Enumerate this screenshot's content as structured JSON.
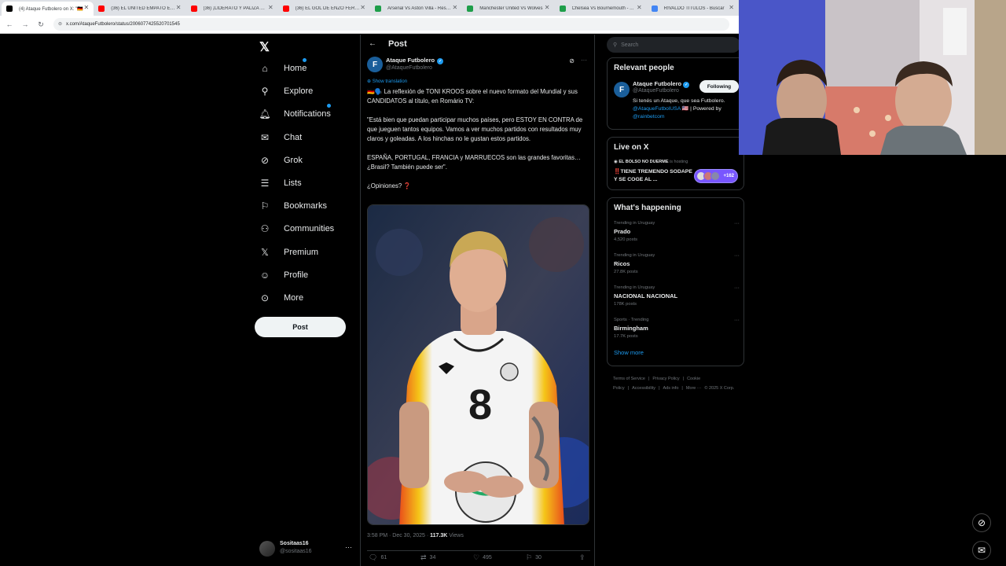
{
  "browser": {
    "tabs": [
      {
        "label": "(4) Ataque Futbolero on X: \"🇩🇪",
        "fav": "#000000",
        "active": true
      },
      {
        "label": "(36) EL UNITED EMPATÓ EN CU",
        "fav": "#ff0000",
        "active": false
      },
      {
        "label": "(36) ¡LIDERATO Y PALIZA GUNI",
        "fav": "#ff0000",
        "active": false
      },
      {
        "label": "(36) EL GOL DE ENZO FERNÁN",
        "fav": "#ff0000",
        "active": false
      },
      {
        "label": "Arsenal Vs Aston Villa - Resulta",
        "fav": "#1e9e4a",
        "active": false
      },
      {
        "label": "Manchester United Vs Wolves",
        "fav": "#1e9e4a",
        "active": false
      },
      {
        "label": "Chelsea Vs Bournemouth - Alin",
        "fav": "#1e9e4a",
        "active": false
      },
      {
        "label": "RIVALDO TITULOS - Buscar",
        "fav": "#4285f4",
        "active": false
      }
    ],
    "url": "x.com/AtaqueFutbolero/status/2006077425520701545"
  },
  "sidebar": {
    "items": [
      {
        "label": "Home",
        "icon": "home-icon",
        "glyph": "⌂",
        "dot": true
      },
      {
        "label": "Explore",
        "icon": "search-icon",
        "glyph": "⚲",
        "dot": false
      },
      {
        "label": "Notifications",
        "icon": "bell-icon",
        "glyph": "🔔︎",
        "dot": true
      },
      {
        "label": "Chat",
        "icon": "mail-icon",
        "glyph": "✉",
        "dot": false
      },
      {
        "label": "Grok",
        "icon": "grok-icon",
        "glyph": "⊘",
        "dot": false
      },
      {
        "label": "Lists",
        "icon": "list-icon",
        "glyph": "☰",
        "dot": false
      },
      {
        "label": "Bookmarks",
        "icon": "bookmark-icon",
        "glyph": "⚐",
        "dot": false
      },
      {
        "label": "Communities",
        "icon": "people-icon",
        "glyph": "⚇",
        "dot": false
      },
      {
        "label": "Premium",
        "icon": "x-icon",
        "glyph": "𝕏",
        "dot": false
      },
      {
        "label": "Profile",
        "icon": "person-icon",
        "glyph": "☺",
        "dot": false
      },
      {
        "label": "More",
        "icon": "more-circle-icon",
        "glyph": "⊙",
        "dot": false
      }
    ],
    "post_label": "Post",
    "account": {
      "name": "Sositaas16",
      "handle": "@sositaas16"
    }
  },
  "post": {
    "header_title": "Post",
    "author_name": "Ataque Futbolero",
    "author_handle": "@AtaqueFutbolero",
    "show_translation": "Show translation",
    "text": "🇩🇪🗣️ La reflexión de TONI KROOS sobre el nuevo formato del Mundial y sus CANDIDATOS al título, en Romário TV:\n\n\"Está bien que puedan participar muchos países, pero ESTOY EN CONTRA de que jueguen tantos equipos. Vamos a ver muchos partidos con resultados muy claros y goleadas. A los hinchas no le gustan estos partidos.\n\nESPAÑA, PORTUGAL, FRANCIA y MARRUECOS son las grandes favoritas… ¿Brasil? También puede ser\".\n\n¿Opiniones? ❓",
    "timestamp": "3:58 PM · Dec 30, 2025 · ",
    "views_count": "117.3K",
    "views_label": " Views",
    "replies": "61",
    "reposts": "34",
    "likes": "495",
    "bookmarks": "30",
    "jersey_number": "8"
  },
  "right": {
    "search_placeholder": "Search",
    "relevant_title": "Relevant people",
    "relevant": {
      "name": "Ataque Futbolero",
      "handle": "@AtaqueFutbolero",
      "follow_label": "Following",
      "bio_1": "Si tenés un Ataque, que sea Futbolero. ",
      "bio_link_1": "@AtaqueFutbolUSA",
      "bio_2": " 🇺🇸 | Powered by ",
      "bio_link_2": "@rainbetcom"
    },
    "live_title": "Live on X",
    "live": {
      "host_name": "EL BOLSO NO DUERME",
      "host_suffix": " is hosting",
      "title": "‼️TIENE TREMENDO SODAPE Y SE COGE AL ...",
      "count": "+162"
    },
    "happening_title": "What's happening",
    "trends": [
      {
        "context": "Trending in Uruguay",
        "name": "Prado",
        "posts": "4,520 posts"
      },
      {
        "context": "Trending in Uruguay",
        "name": "Ricos",
        "posts": "27.8K posts"
      },
      {
        "context": "Trending in Uruguay",
        "name": "NACIONAL NACIONAL",
        "posts": "178K posts"
      },
      {
        "context": "Sports · Trending",
        "name": "Birmingham",
        "posts": "17.7K posts"
      }
    ],
    "show_more": "Show more",
    "footer": [
      "Terms of Service",
      "|",
      "Privacy Policy",
      "|",
      "Cookie Policy",
      "|",
      "Accessibility",
      "|",
      "Ads info",
      "|",
      "More ···",
      "© 2025 X Corp."
    ]
  },
  "colors": {
    "accent": "#1d9bf0",
    "background": "#000000",
    "border": "#2f3336",
    "muted": "#71767b"
  }
}
